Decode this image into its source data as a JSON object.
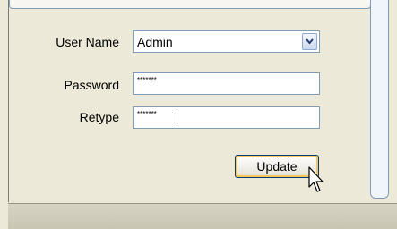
{
  "form": {
    "username_label": "User Name",
    "username_value": "Admin",
    "password_label": "Password",
    "password_value": "*******",
    "retype_label": "Retype",
    "retype_value": "*******"
  },
  "actions": {
    "update_label": "Update"
  },
  "icons": {
    "dropdown": "chevron-down-icon",
    "cursor": "mouse-pointer-icon"
  }
}
